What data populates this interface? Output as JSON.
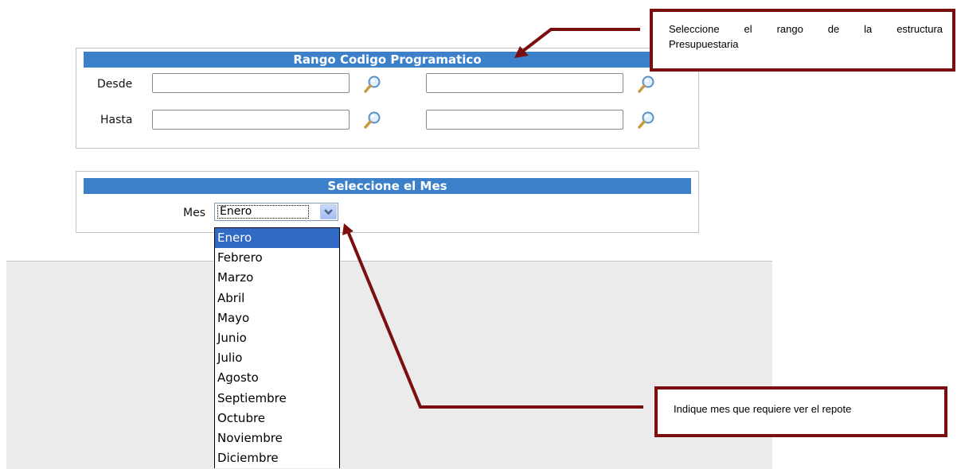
{
  "range_panel": {
    "title": "Rango Codigo Programatico",
    "desde_label": "Desde",
    "hasta_label": "Hasta",
    "fields": {
      "desde_1": "",
      "desde_2": "",
      "hasta_1": "",
      "hasta_2": ""
    },
    "lookup_icon": "magnifier-icon"
  },
  "month_panel": {
    "title": "Seleccione el Mes",
    "mes_label": "Mes",
    "selected": "Enero",
    "options": [
      "Enero",
      "Febrero",
      "Marzo",
      "Abril",
      "Mayo",
      "Junio",
      "Julio",
      "Agosto",
      "Septiembre",
      "Octubre",
      "Noviembre",
      "Diciembre"
    ],
    "dropdown_icon": "chevron-down-icon"
  },
  "callouts": {
    "range_line1": "Seleccione el rango de la estructura",
    "range_line2": "Presupuestaria",
    "month": "Indique mes que requiere ver el repote"
  },
  "colors": {
    "header_blue": "#3b80c9",
    "selected_blue": "#316ac5",
    "callout_border": "#7b0f0f"
  }
}
